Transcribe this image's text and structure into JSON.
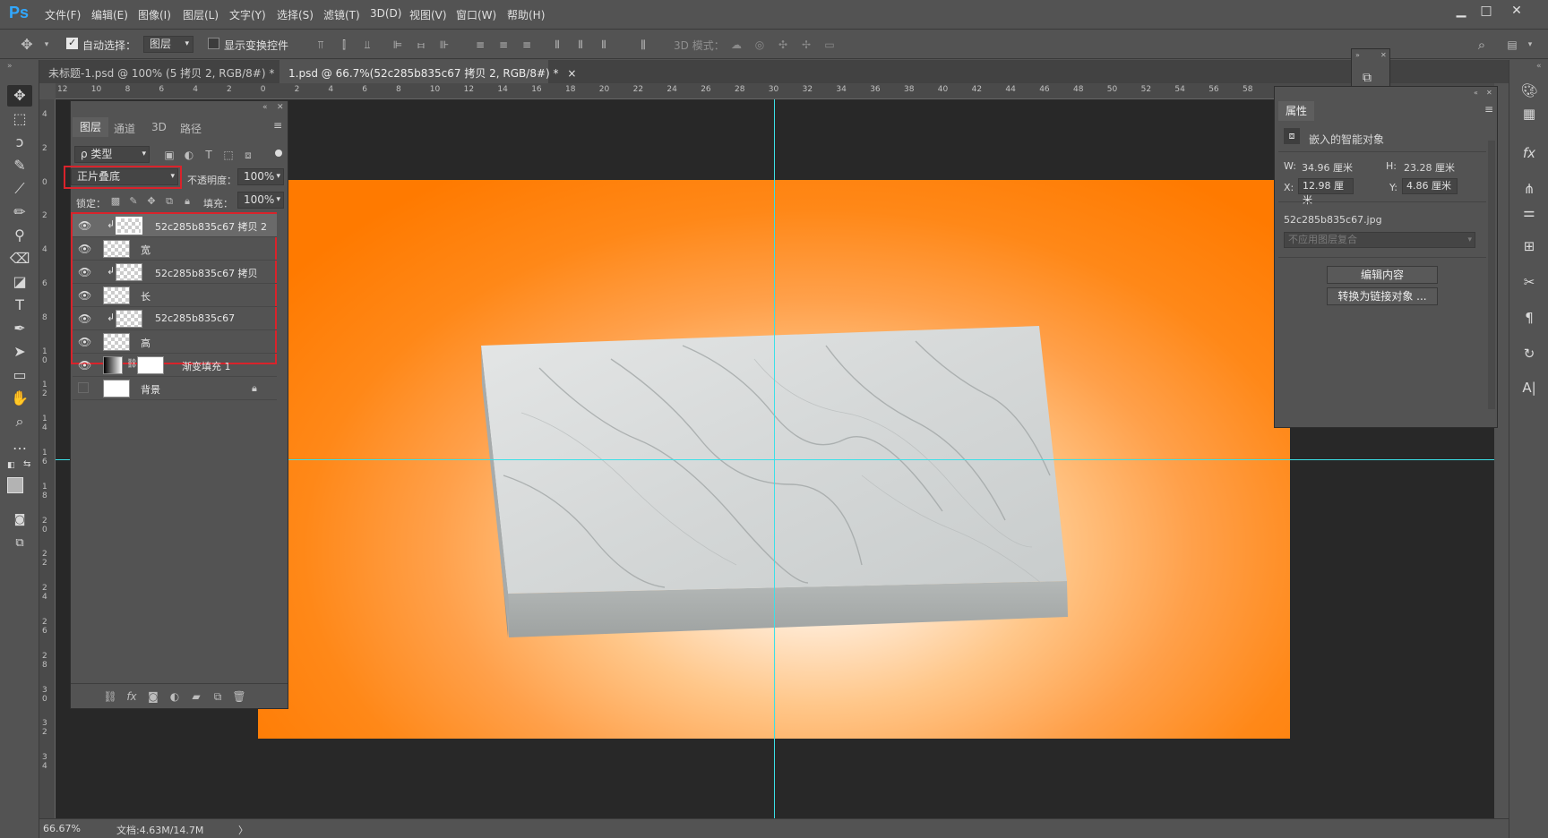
{
  "app": {
    "logo": "Ps"
  },
  "menu": [
    "文件(F)",
    "编辑(E)",
    "图像(I)",
    "图层(L)",
    "文字(Y)",
    "选择(S)",
    "滤镜(T)",
    "3D(D)",
    "视图(V)",
    "窗口(W)",
    "帮助(H)"
  ],
  "window_controls": {
    "minimize": "▁",
    "maximize": "□",
    "close": "✕"
  },
  "options": {
    "auto_select_label": "自动选择：",
    "auto_select_checked": true,
    "auto_select_target": "图层",
    "show_transform_label": "显示变换控件",
    "show_transform_checked": false,
    "mode_3d_label": "3D 模式："
  },
  "tabs": [
    {
      "label": "未标题-1.psd @ 100% (5 拷贝 2, RGB/8#) *",
      "close": "×",
      "active": false
    },
    {
      "label": "1.psd @ 66.7%(52c285b835c67 拷贝 2, RGB/8#) *",
      "close": "×",
      "active": true
    }
  ],
  "ruler_top": [
    "12",
    "10",
    "8",
    "6",
    "4",
    "2",
    "0",
    "2",
    "4",
    "6",
    "8",
    "10",
    "12",
    "14",
    "16",
    "18",
    "20",
    "22",
    "24",
    "26",
    "28",
    "30",
    "32",
    "34",
    "36",
    "38",
    "40",
    "42",
    "44",
    "46",
    "48",
    "50",
    "52",
    "54",
    "56",
    "58"
  ],
  "ruler_left": [
    "4",
    "2",
    "0",
    "2",
    "4",
    "6",
    "8",
    "1 0",
    "1 2",
    "1 4",
    "1 6",
    "1 8",
    "2 0",
    "2 2",
    "2 4",
    "2 6",
    "2 8",
    "3 0",
    "3 2",
    "3 4"
  ],
  "layers_panel": {
    "tabs": [
      "图层",
      "通道",
      "3D",
      "路径"
    ],
    "filter_label": "ρ 类型",
    "blend_mode": "正片叠底",
    "opacity_label": "不透明度：",
    "opacity_value": "100%",
    "lock_label": "锁定：",
    "fill_label": "填充：",
    "fill_value": "100%",
    "layers": [
      {
        "name": "52c285b835c67 拷贝 2",
        "visible": true,
        "clipped": true,
        "selected": true
      },
      {
        "name": "宽",
        "visible": true,
        "clipped": false,
        "selected": false
      },
      {
        "name": "52c285b835c67 拷贝",
        "visible": true,
        "clipped": true,
        "selected": false
      },
      {
        "name": "长",
        "visible": true,
        "clipped": false,
        "selected": false
      },
      {
        "name": "52c285b835c67",
        "visible": true,
        "clipped": true,
        "selected": false
      },
      {
        "name": "高",
        "visible": true,
        "clipped": false,
        "selected": false
      },
      {
        "name": "渐变填充 1",
        "visible": true,
        "clipped": false,
        "selected": false
      },
      {
        "name": "背景",
        "visible": false,
        "clipped": false,
        "selected": false
      }
    ],
    "footer_icons": [
      "link-icon",
      "fx-icon",
      "mask-icon",
      "adjustment-icon",
      "folder-icon",
      "new-layer-icon",
      "trash-icon"
    ]
  },
  "properties_panel": {
    "title": "属性",
    "type_label": "嵌入的智能对象",
    "w_label": "W:",
    "w_value": "34.96 厘米",
    "h_label": "H:",
    "h_value": "23.28 厘米",
    "x_label": "X:",
    "x_value": "12.98 厘米",
    "y_label": "Y:",
    "y_value": "4.86 厘米",
    "filename": "52c285b835c67.jpg",
    "comp_placeholder": "不应用图层复合",
    "edit_btn": "编辑内容",
    "convert_btn": "转换为链接对象 ..."
  },
  "status": {
    "zoom": "66.67%",
    "doc_info": "文档:4.63M/14.7M",
    "arrow": "〉"
  },
  "colors": {
    "accent_orange": "#ff7a00",
    "guide": "#3be0e8",
    "highlight_red": "#d9232b",
    "ps_blue": "#31a8ff"
  }
}
